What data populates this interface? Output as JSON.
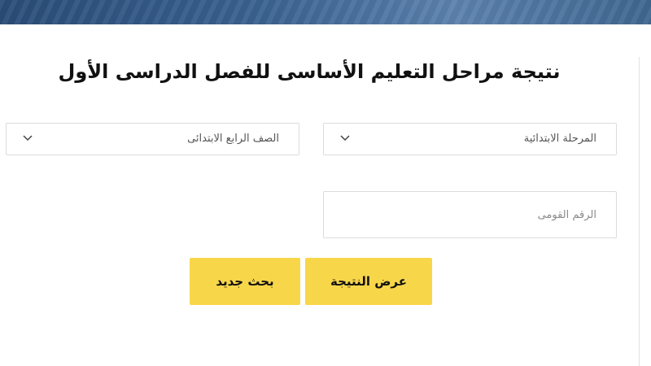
{
  "header": {
    "title": "نتيجة مراحل التعليم الأساسى للفصل الدراسى الأول"
  },
  "form": {
    "stage_select": {
      "value": "المرحلة الابتدائية",
      "icon": "chevron-down-icon"
    },
    "grade_select": {
      "value": "الصف الرابع الابتدائى",
      "icon": "chevron-down-icon"
    },
    "national_id": {
      "placeholder": "الرقم القومى",
      "value": ""
    },
    "buttons": {
      "show_result": "عرض النتيجة",
      "new_search": "بحث جديد"
    }
  },
  "colors": {
    "button_bg": "#f8d64a",
    "banner": "#3a6290",
    "border": "#dcdcdc"
  }
}
